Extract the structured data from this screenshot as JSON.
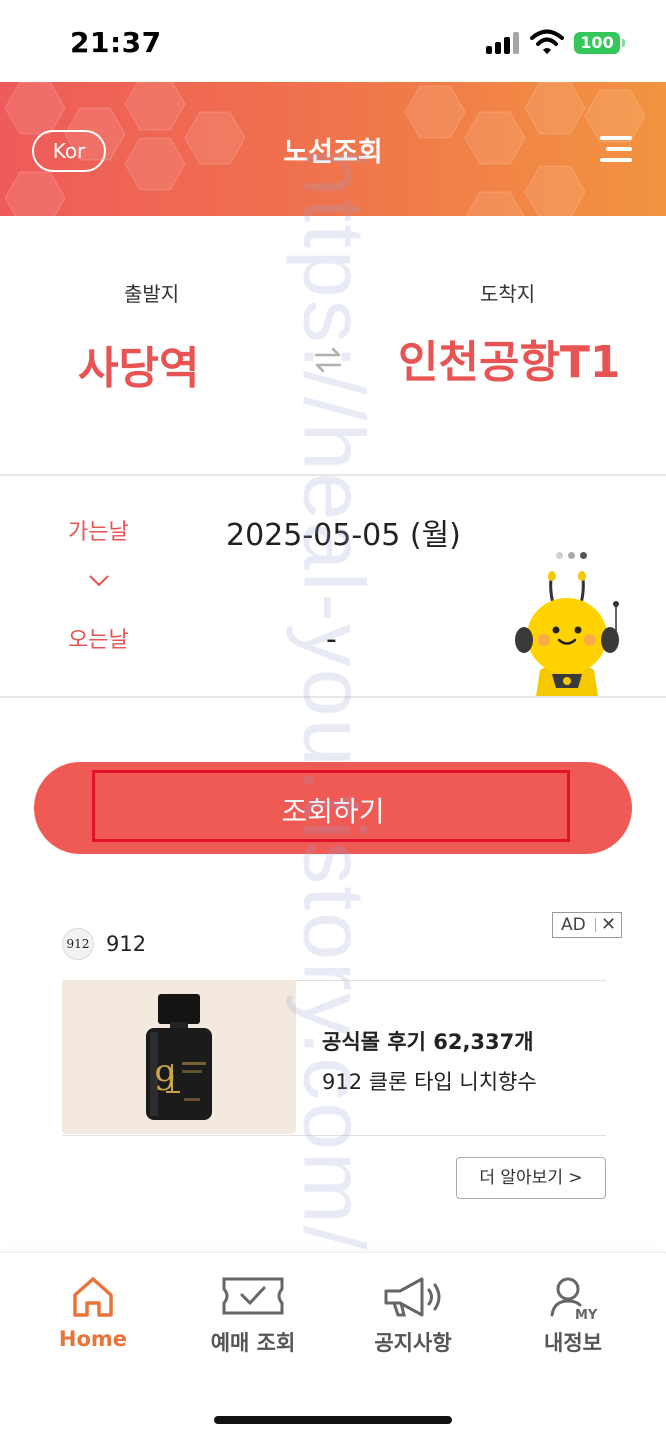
{
  "status_bar": {
    "time": "21:37",
    "battery": "100"
  },
  "header": {
    "language": "Kor",
    "title": "노선조회"
  },
  "route": {
    "departure_label": "출발지",
    "departure": "사당역",
    "arrival_label": "도착지",
    "arrival": "인천공항T1"
  },
  "dates": {
    "outbound_label": "가는날",
    "outbound_value": "2025-05-05 (월)",
    "return_label": "오는날",
    "return_value": "-"
  },
  "search": {
    "label": "조회하기"
  },
  "ad": {
    "badge": "AD",
    "close": "✕",
    "brand_logo": "912",
    "brand_name": "912",
    "headline": "공식몰 후기 62,337개",
    "description": "912 클론 타입 니치향수",
    "cta": "더 알아보기 >"
  },
  "nav": {
    "items": [
      {
        "label": "Home",
        "icon": "home-icon",
        "active": true
      },
      {
        "label": "예매 조회",
        "icon": "ticket-icon",
        "active": false
      },
      {
        "label": "공지사항",
        "icon": "megaphone-icon",
        "active": false
      },
      {
        "label": "내정보",
        "icon": "user-my-icon",
        "active": false
      }
    ]
  },
  "colors": {
    "accent": "#ef5a54",
    "header_gradient_start": "#ef5a5a",
    "header_gradient_end": "#f29440",
    "active_nav": "#e8743a",
    "highlight_box": "#e0132a"
  },
  "watermark": "https://heal-you.tistory.com/"
}
